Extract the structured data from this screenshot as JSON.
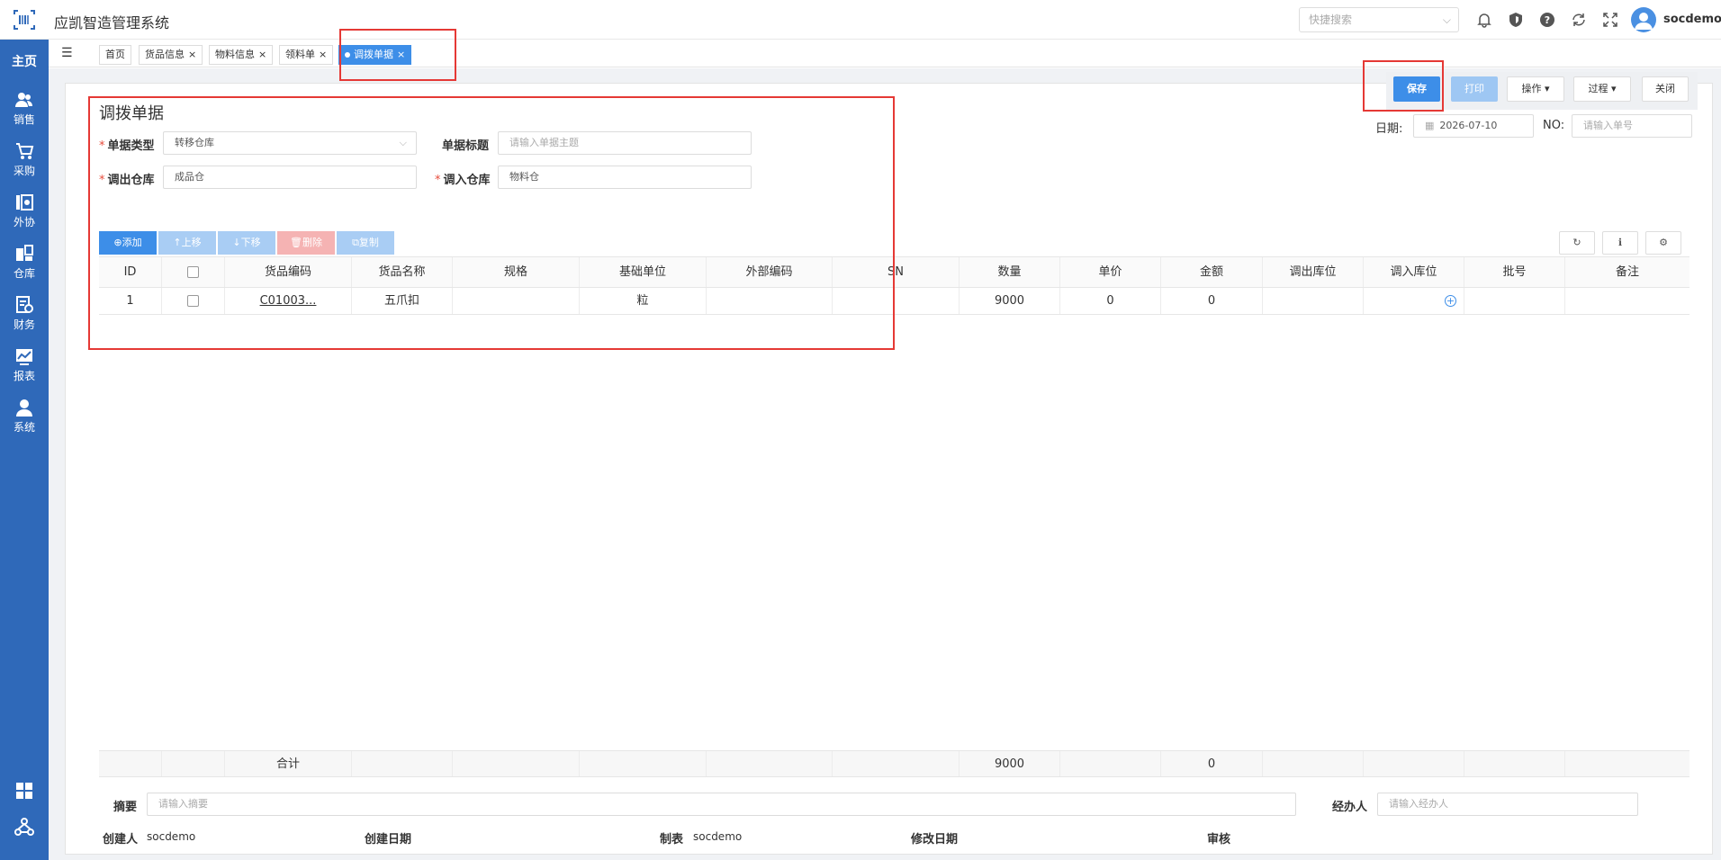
{
  "app": {
    "title": "应凯智造管理系统"
  },
  "header": {
    "search_placeholder": "快捷搜索",
    "user_name": "socdemo",
    "icons": [
      "bell-icon",
      "shield-icon",
      "help-icon",
      "refresh-icon",
      "fullscreen-icon"
    ]
  },
  "sidebar": {
    "home": "主页",
    "items": [
      {
        "label": "销售",
        "icon": "users-icon"
      },
      {
        "label": "采购",
        "icon": "cart-icon"
      },
      {
        "label": "外协",
        "icon": "outsource-icon"
      },
      {
        "label": "仓库",
        "icon": "warehouse-icon"
      },
      {
        "label": "财务",
        "icon": "finance-icon"
      },
      {
        "label": "报表",
        "icon": "chart-icon"
      },
      {
        "label": "系统",
        "icon": "user-icon"
      }
    ]
  },
  "tabs": [
    {
      "label": "首页"
    },
    {
      "label": "货品信息",
      "close": "×"
    },
    {
      "label": "物料信息",
      "close": "×"
    },
    {
      "label": "领料单",
      "close": "×"
    },
    {
      "label": "调拨单据",
      "close": "×",
      "active": true
    }
  ],
  "actions": {
    "save": "保存",
    "print": "打印",
    "operate": "操作",
    "process": "过程",
    "close": "关闭"
  },
  "meta": {
    "date_label": "日期:",
    "date_value": "2026-07-10",
    "no_label": "NO:",
    "no_placeholder": "请输入单号"
  },
  "form": {
    "title": "调拨单据",
    "type_label": "单据类型",
    "type_value": "转移仓库",
    "subject_label": "单据标题",
    "subject_placeholder": "请输入单据主题",
    "from_label": "调出仓库",
    "from_value": "成品仓",
    "to_label": "调入仓库",
    "to_value": "物料仓"
  },
  "grid_toolbar": {
    "add": "⊕添加",
    "up": "↑上移",
    "down": "↓下移",
    "delete": "🗑删除",
    "copy": "⧉复制"
  },
  "grid": {
    "columns": [
      "ID",
      "",
      "货品编码",
      "货品名称",
      "规格",
      "基础单位",
      "外部编码",
      "SN",
      "数量",
      "单价",
      "金额",
      "调出库位",
      "调入库位",
      "批号",
      "备注"
    ],
    "rows": [
      {
        "id": "1",
        "code": "C01003...",
        "name": "五爪扣",
        "spec": "",
        "unit": "粒",
        "ext_code": "",
        "sn": "",
        "qty": "9000",
        "price": "0",
        "amount": "0",
        "out_loc": "",
        "in_loc": "",
        "batch": "",
        "remark": ""
      }
    ],
    "footer": {
      "label": "合计",
      "qty": "9000",
      "amount": "0"
    }
  },
  "bottom": {
    "summary_label": "摘要",
    "summary_placeholder": "请输入摘要",
    "handler_label": "经办人",
    "handler_placeholder": "请输入经办人",
    "creator_label": "创建人",
    "creator_value": "socdemo",
    "created_label": "创建日期",
    "maker_label": "制表",
    "maker_value": "socdemo",
    "modified_label": "修改日期",
    "audit_label": "审核"
  }
}
